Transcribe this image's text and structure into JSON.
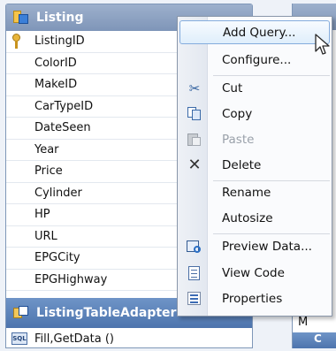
{
  "table": {
    "title": "Listing",
    "columns": [
      "ListingID",
      "ColorID",
      "MakeID",
      "CarTypeID",
      "DateSeen",
      "Year",
      "Price",
      "Cylinder",
      "HP",
      "URL",
      "EPGCity",
      "EPGHighway"
    ]
  },
  "adapter": {
    "title": "ListingTableAdapter",
    "query": "Fill,GetData ()",
    "sql_icon_label": "SQL"
  },
  "background": {
    "partial_row_text": "M",
    "partial_header_text": "C"
  },
  "context_menu": {
    "items": [
      {
        "label": "Add Query...",
        "icon": "none"
      },
      {
        "label": "Configure...",
        "icon": "none"
      },
      {
        "label": "Cut",
        "icon": "scissors-icon"
      },
      {
        "label": "Copy",
        "icon": "copy-icon"
      },
      {
        "label": "Paste",
        "icon": "paste-icon"
      },
      {
        "label": "Delete",
        "icon": "delete-icon"
      },
      {
        "label": "Rename",
        "icon": "none"
      },
      {
        "label": "Autosize",
        "icon": "none"
      },
      {
        "label": "Preview Data...",
        "icon": "preview-data-icon"
      },
      {
        "label": "View Code",
        "icon": "view-code-icon"
      },
      {
        "label": "Properties",
        "icon": "properties-icon"
      }
    ]
  },
  "colors": {
    "header_gray_blue": "#8fa4c4",
    "adapter_blue": "#5a80b8",
    "highlight_border": "#84acdd",
    "disabled_text": "#9aa1aa"
  }
}
